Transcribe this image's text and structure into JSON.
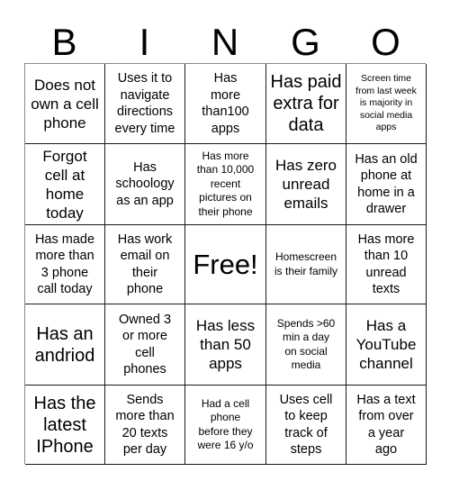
{
  "card": {
    "title": "BINGO",
    "header_letters": [
      "B",
      "I",
      "N",
      "G",
      "O"
    ],
    "rows": [
      [
        {
          "text": "Does not\nown a cell\nphone",
          "size": "fs-l"
        },
        {
          "text": "Uses it to\nnavigate\ndirections\nevery time",
          "size": "fs-m"
        },
        {
          "text": "Has\nmore\nthan100\napps",
          "size": "fs-m"
        },
        {
          "text": "Has paid\nextra for\ndata",
          "size": "fs-xl"
        },
        {
          "text": "Screen time\nfrom last week\nis majority in\nsocial media\napps",
          "size": "fs-xs"
        }
      ],
      [
        {
          "text": "Forgot\ncell at\nhome\ntoday",
          "size": "fs-l"
        },
        {
          "text": "Has\nschoology\nas an app",
          "size": "fs-m"
        },
        {
          "text": "Has more\nthan 10,000\nrecent\npictures on\ntheir phone",
          "size": "fs-s"
        },
        {
          "text": "Has zero\nunread\nemails",
          "size": "fs-l"
        },
        {
          "text": "Has an old\nphone at\nhome in a\ndrawer",
          "size": "fs-m"
        }
      ],
      [
        {
          "text": "Has made\nmore than\n3 phone\ncall today",
          "size": "fs-m"
        },
        {
          "text": "Has work\nemail on\ntheir\nphone",
          "size": "fs-m"
        },
        {
          "text": "Free!",
          "size": "fs-free"
        },
        {
          "text": "Homescreen\nis their family",
          "size": "fs-s"
        },
        {
          "text": "Has more\nthan 10\nunread\ntexts",
          "size": "fs-m"
        }
      ],
      [
        {
          "text": "Has an\nandriod",
          "size": "fs-xl"
        },
        {
          "text": "Owned 3\nor more\ncell\nphones",
          "size": "fs-m"
        },
        {
          "text": "Has less\nthan 50\napps",
          "size": "fs-l"
        },
        {
          "text": "Spends >60\nmin a day\non social\nmedia",
          "size": "fs-s"
        },
        {
          "text": "Has a\nYouTube\nchannel",
          "size": "fs-l"
        }
      ],
      [
        {
          "text": "Has the\nlatest\nIPhone",
          "size": "fs-xl"
        },
        {
          "text": "Sends\nmore than\n20 texts\nper day",
          "size": "fs-m"
        },
        {
          "text": "Had a cell\nphone\nbefore they\nwere 16 y/o",
          "size": "fs-s"
        },
        {
          "text": "Uses cell\nto keep\ntrack of\nsteps",
          "size": "fs-m"
        },
        {
          "text": "Has a text\nfrom over\na year\nago",
          "size": "fs-m"
        }
      ]
    ],
    "free_space": {
      "row": 2,
      "col": 2,
      "label": "Free!"
    },
    "colors": {
      "background": "#ffffff",
      "text": "#000000",
      "grid_line": "#1a1a1a"
    }
  }
}
